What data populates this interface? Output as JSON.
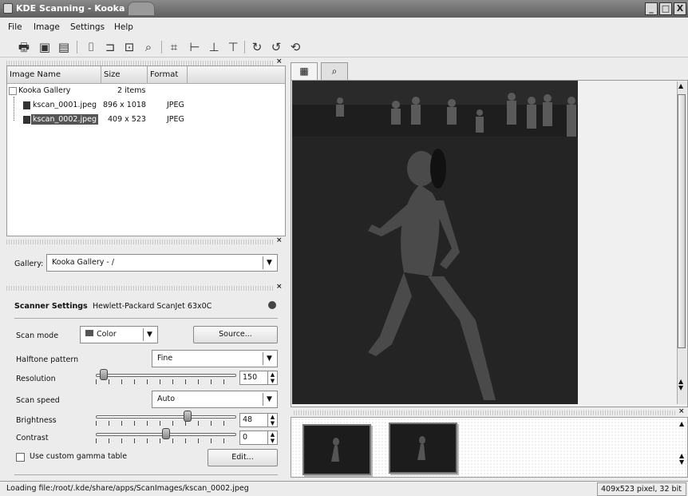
{
  "window": {
    "title": "KDE Scanning - Kooka"
  },
  "menu": {
    "file": "File",
    "image": "Image",
    "settings": "Settings",
    "help": "Help"
  },
  "gallery_list": {
    "headers": {
      "name": "Image Name",
      "size": "Size",
      "format": "Format"
    },
    "root": {
      "name": "Kooka Gallery",
      "size": "2 items"
    },
    "items": [
      {
        "name": "kscan_0001.jpeg",
        "size": "896 x 1018",
        "format": "JPEG"
      },
      {
        "name": "kscan_0002.jpeg",
        "size": "409 x 523",
        "format": "JPEG"
      }
    ]
  },
  "gallery_select": {
    "label": "Gallery:",
    "value": "Kooka Gallery - /"
  },
  "scanner": {
    "heading": "Scanner Settings",
    "device": "Hewlett-Packard ScanJet 63x0C",
    "scan_mode_label": "Scan mode",
    "scan_mode_value": "Color",
    "source_button": "Source...",
    "halftone_label": "Halftone pattern",
    "halftone_value": "Fine",
    "resolution_label": "Resolution",
    "resolution_value": "150",
    "scan_speed_label": "Scan speed",
    "scan_speed_value": "Auto",
    "brightness_label": "Brightness",
    "brightness_value": "48",
    "contrast_label": "Contrast",
    "contrast_value": "0",
    "gamma_label": "Use custom gamma table",
    "edit_button": "Edit..."
  },
  "slider_levels": {
    "resolution": 0.03,
    "brightness": 0.66,
    "contrast": 0.5
  },
  "statusbar": {
    "message": "Loading file:/root/.kde/share/apps/ScanImages/kscan_0002.jpeg",
    "image_info": "409x523 pixel, 32 bit"
  }
}
